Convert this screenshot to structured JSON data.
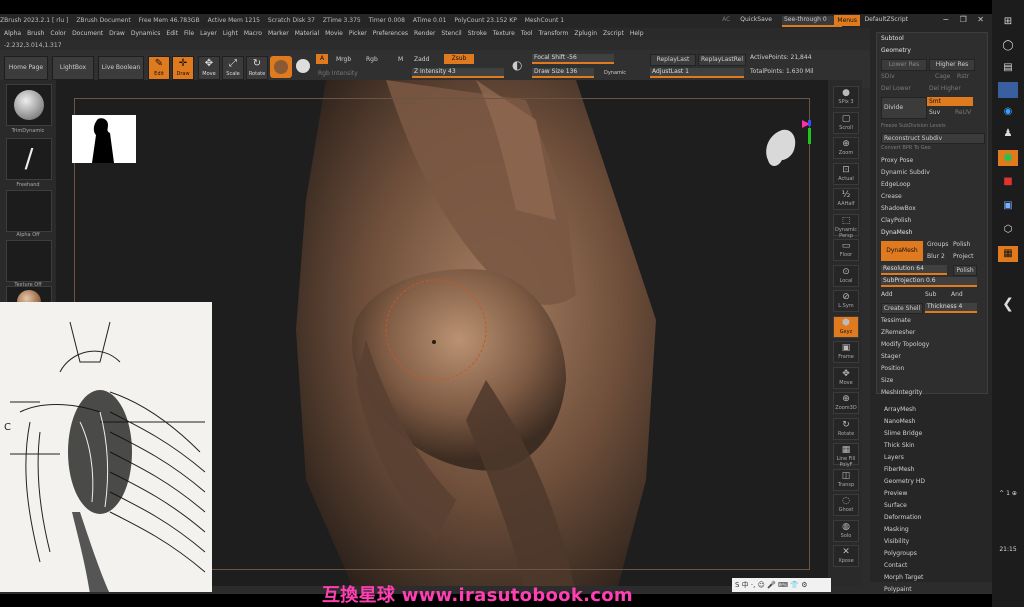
{
  "titlebar": {
    "info": [
      "ZBrush 2023.2.1 [ rlu ]",
      "ZBrush Document",
      "Free Mem 46.783GB",
      "Active Mem 1215",
      "Scratch Disk 37",
      "ZTime 3.375",
      "Timer 0.008",
      "ATime 0.01",
      "PolyCount 23.152 KP",
      "MeshCount 1"
    ],
    "ac_label": "AC",
    "quicksave": "QuickSave",
    "see_through": "See-through 0",
    "menus_label": "Menus",
    "default_script": "DefaultZScript",
    "window_controls": "− ❐ ✕"
  },
  "menubar": [
    "Alpha",
    "Brush",
    "Color",
    "Document",
    "Draw",
    "Dynamics",
    "Edit",
    "File",
    "Layer",
    "Light",
    "Macro",
    "Marker",
    "Material",
    "Movie",
    "Picker",
    "Preferences",
    "Render",
    "Stencil",
    "Stroke",
    "Texture",
    "Tool",
    "Transform",
    "Zplugin",
    "Zscript",
    "Help"
  ],
  "coords": "-2.232,3.014,1.317",
  "shelf": {
    "home": "Home Page",
    "lightbox": "LightBox",
    "live_boolean": "Live Boolean",
    "tools": [
      {
        "label": "Edit",
        "icon": "edit-icon",
        "glyph": "✎",
        "active": true
      },
      {
        "label": "Draw",
        "icon": "draw-icon",
        "glyph": "✛",
        "active": true
      },
      {
        "label": "Move",
        "icon": "move-icon",
        "glyph": "✥",
        "active": false
      },
      {
        "label": "Scale",
        "icon": "scale-icon",
        "glyph": "⤢",
        "active": false
      },
      {
        "label": "Rotate",
        "icon": "rotate-icon",
        "glyph": "↻",
        "active": false
      }
    ],
    "a_label": "A",
    "mrgb": "Mrgb",
    "rgb": "Rgb",
    "m": "M",
    "zadd": "Zadd",
    "zsub": "Zsub",
    "rgb_intensity": "Rgb Intensity",
    "z_intensity": "Z Intensity 43",
    "focal_shift": "Focal Shift -56",
    "draw_size": "Draw Size 136",
    "dynamic": "Dynamic",
    "replay_last": "ReplayLast",
    "replay_last_rel": "ReplayLastRel",
    "adjust_last": "AdjustLast 1",
    "active_points": "ActivePoints: 21,844",
    "total_points": "TotalPoints: 1.630 Mil"
  },
  "left_shelf": [
    {
      "label": "TrimDynamic",
      "icon": "trimdynamic-brush-icon"
    },
    {
      "label": "Freehand",
      "icon": "freehand-stroke-icon"
    },
    {
      "label": "Alpha Off",
      "icon": "alpha-off-icon"
    },
    {
      "label": "Texture Off",
      "icon": "texture-off-icon"
    },
    {
      "label": "",
      "icon": "material-sphere-icon"
    }
  ],
  "right_shelf": [
    "SPix 3",
    "Scroll",
    "Zoom",
    "Actual",
    "AAHalf",
    "Dynamic Persp",
    "Floor",
    "Local",
    "L.Sym",
    "Gxyz",
    "Frame",
    "Move",
    "Zoom3D",
    "Rotate",
    "Line Fill PolyF",
    "Transp",
    "Ghost",
    "Solo",
    "Xpose"
  ],
  "subtool_panel": {
    "title": "Subtool",
    "geometry": "Geometry",
    "lower_res": "Lower Res",
    "higher_res": "Higher Res",
    "sdiv": "SDiv",
    "cage": "Cage",
    "rstr": "Rstr",
    "del_lower": "Del Lower",
    "del_higher": "Del Higher",
    "divide": "Divide",
    "smt": "Smt",
    "suv": "Suv",
    "reuv": "ReUV",
    "freeze_subdiv": "Freeze SubDivision Levels",
    "reconstruct": "Reconstruct Subdiv",
    "convert_bpr": "Convert BPR To Geo",
    "items_a": [
      "Proxy Pose",
      "Dynamic Subdiv",
      "EdgeLoop",
      "Crease",
      "ShadowBox",
      "ClayPolish"
    ],
    "dynamesh_header": "DynaMesh",
    "dynamesh_btn": "DynaMesh",
    "groups": "Groups",
    "polish": "Polish",
    "blur": "Blur 2",
    "project": "Project",
    "resolution": "Resolution 64",
    "polish_btn": "Polish",
    "subprojection": "SubProjection 0.6",
    "add": "Add",
    "sub": "Sub",
    "and": "And",
    "create_shell": "Create Shell",
    "thickness": "Thickness 4",
    "items_b": [
      "Tessimate",
      "ZRemesher",
      "Modify Topology",
      "Stager",
      "Position",
      "Size",
      "MeshIntegrity"
    ]
  },
  "tray_list": [
    "ArrayMesh",
    "NanoMesh",
    "Slime Bridge",
    "Thick Skin",
    "Layers",
    "FiberMesh",
    "Geometry HD",
    "Preview",
    "Surface",
    "Deformation",
    "Masking",
    "Visibility",
    "Polygroups",
    "Contact",
    "Morph Target",
    "Polypaint"
  ],
  "taskbar": {
    "icons": [
      "windows-icon",
      "search-icon",
      "task-view-icon",
      "app-icon-1",
      "browser-icon",
      "app-icon-2",
      "wechat-icon",
      "app-icon-3",
      "app-icon-4",
      "app-icon-5",
      "app-icon-6"
    ],
    "arrow": "❮",
    "time": "21:15",
    "tray_small": "^ 1 ⊕"
  },
  "ime_bar": "S 中 ·, ☺ 🎤 ⌨ 👕 ⚙",
  "reference_labels": {
    "c": "C"
  },
  "watermark": "互換星球 www.irasutobook.com"
}
